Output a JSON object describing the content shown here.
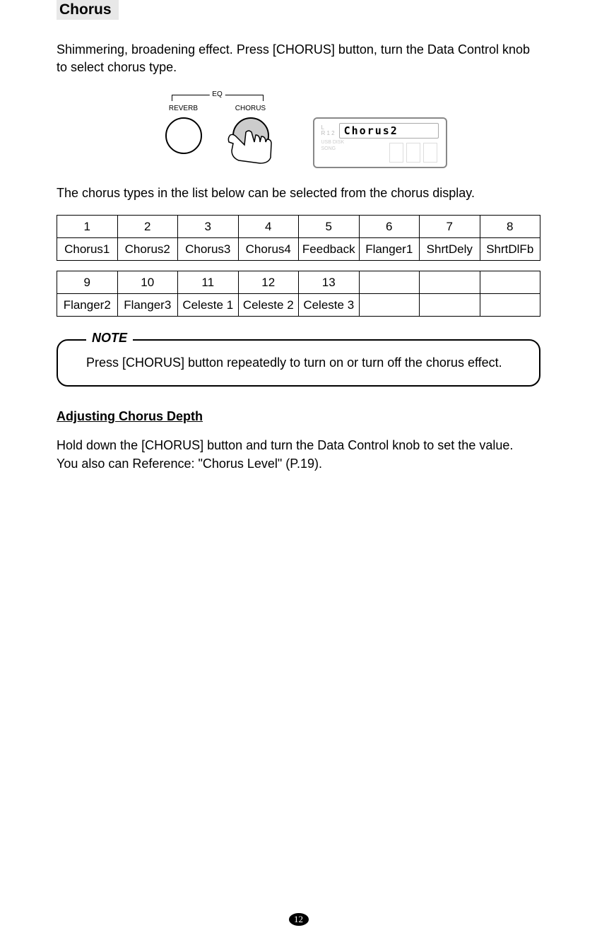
{
  "section_title": "Chorus",
  "intro": "Shimmering, broadening effect. Press [CHORUS] button, turn the Data Control knob to select chorus type.",
  "diagram": {
    "eq_label": "EQ",
    "reverb_label": "REVERB",
    "chorus_label": "CHORUS",
    "display_text": "Chorus2",
    "display_side_l": "L",
    "display_side_r": "R 1 2",
    "display_sub1": "USB DISK",
    "display_sub2": "SONG"
  },
  "list_intro": "The chorus types in the list below can be selected from the chorus display.",
  "table1": {
    "headers": [
      "1",
      "2",
      "3",
      "4",
      "5",
      "6",
      "7",
      "8"
    ],
    "row": [
      "Chorus1",
      "Chorus2",
      "Chorus3",
      "Chorus4",
      "Feedback",
      "Flanger1",
      "ShrtDely",
      "ShrtDlFb"
    ]
  },
  "table2": {
    "headers": [
      "9",
      "10",
      "11",
      "12",
      "13",
      "",
      "",
      ""
    ],
    "row": [
      "Flanger2",
      "Flanger3",
      "Celeste 1",
      "Celeste 2",
      "Celeste 3",
      "",
      "",
      ""
    ]
  },
  "note": {
    "label": "NOTE",
    "text": "Press [CHORUS] button repeatedly to turn on or turn off the chorus effect."
  },
  "subheading": "Adjusting Chorus Depth",
  "body1": "Hold down the [CHORUS] button and turn the Data Control knob to set the value.",
  "body2": "You also can Reference: \"Chorus Level\" (P.19).",
  "page_number": "12"
}
